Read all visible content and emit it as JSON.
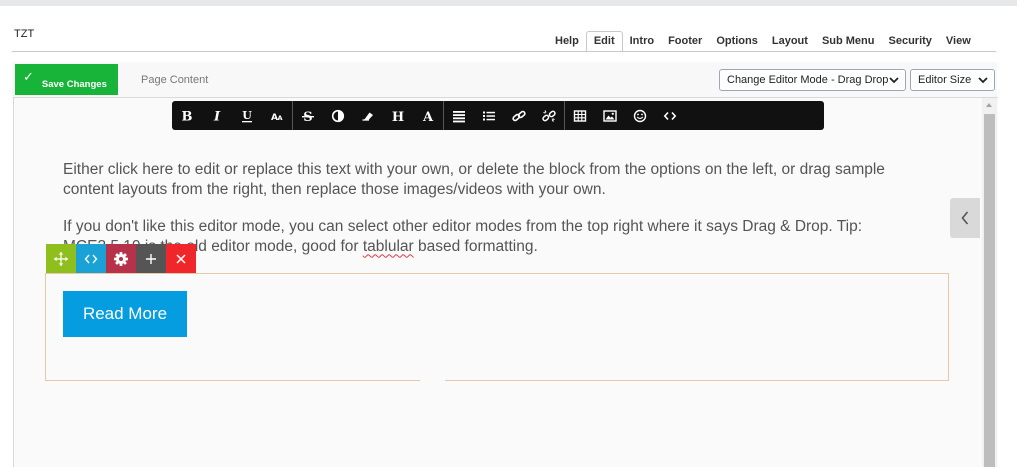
{
  "site": {
    "title": "TZT"
  },
  "tabs": [
    {
      "label": "Help",
      "active": false
    },
    {
      "label": "Edit",
      "active": true
    },
    {
      "label": "Intro",
      "active": false
    },
    {
      "label": "Footer",
      "active": false
    },
    {
      "label": "Options",
      "active": false
    },
    {
      "label": "Layout",
      "active": false
    },
    {
      "label": "Sub Menu",
      "active": false
    },
    {
      "label": "Security",
      "active": false
    },
    {
      "label": "View",
      "active": false
    }
  ],
  "actions": {
    "save_label": "Save Changes",
    "page_content_label": "Page Content",
    "editor_mode": {
      "selected": "Change Editor Mode - Drag Drop"
    },
    "editor_size": {
      "selected": "Editor Size"
    }
  },
  "toolbar": {
    "groups": [
      [
        "bold",
        "italic",
        "underline",
        "font-size"
      ],
      [
        "strikethrough",
        "contrast",
        "eraser",
        "heading",
        "text-style"
      ],
      [
        "paragraph-align",
        "list",
        "link",
        "unlink"
      ],
      [
        "table",
        "image",
        "emoji",
        "source-code"
      ]
    ]
  },
  "content": {
    "paragraph1": "Either click here to edit or replace this text with your own, or delete the block from the options on the left, or drag sample content layouts from the right, then replace those images/videos with your own.",
    "paragraph2_part1": "If you don't like this editor mode, you can select other editor modes from the top right where it says Drag & Drop. Tip: MCE3.5.10 is the old editor mode, good for ",
    "paragraph2_misspelled": "tablular",
    "paragraph2_part2": " based formatting.",
    "button_label": "Read More"
  },
  "colors": {
    "save": "#18b43a",
    "read_more": "#069de0",
    "move": "#8fbf1d",
    "code": "#1aa1d6",
    "settings": "#b5324a",
    "add": "#555555",
    "delete": "#f0272a"
  }
}
